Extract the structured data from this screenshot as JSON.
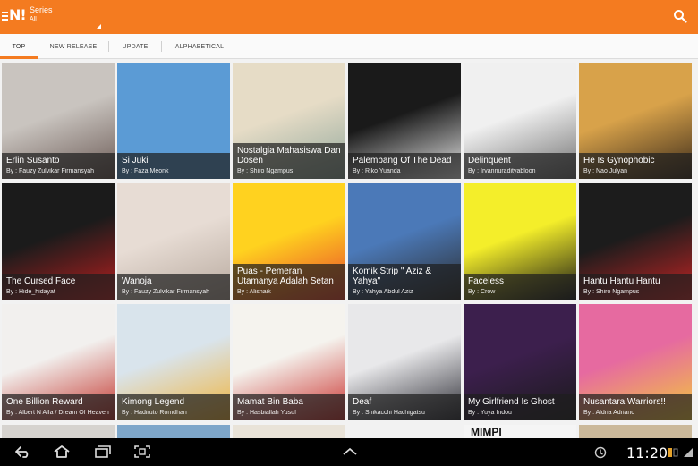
{
  "app": {
    "logo": "N!",
    "section_title": "Series",
    "section_filter": "All"
  },
  "tabs": [
    {
      "label": "TOP",
      "active": true
    },
    {
      "label": "NEW RELEASE",
      "active": false
    },
    {
      "label": "UPDATE",
      "active": false
    },
    {
      "label": "ALPHABETICAL",
      "active": false
    }
  ],
  "comics": [
    {
      "title": "Erlin Susanto",
      "author": "By : Fauzy Zulvikar Firmansyah",
      "colors": [
        "#c9c4bf",
        "#6b5a55"
      ]
    },
    {
      "title": "Si Juki",
      "author": "By : Faza Meonk",
      "colors": [
        "#5b9bd5",
        "#5b9bd5"
      ]
    },
    {
      "title": "Nostalgia Mahasiswa Dan Dosen",
      "author": "By : Shiro Ngampus",
      "colors": [
        "#e6dcc6",
        "#8fa69b"
      ]
    },
    {
      "title": "Palembang Of The Dead",
      "author": "By : Riko Yuanda",
      "colors": [
        "#1a1a1a",
        "#e8e8e8"
      ]
    },
    {
      "title": "Delinquent",
      "author": "By : Irvannuradityabloon",
      "colors": [
        "#f0f0f0",
        "#6f6f6f"
      ]
    },
    {
      "title": "He Is Gynophobic",
      "author": "By : Nao Julyan",
      "colors": [
        "#d8a24a",
        "#3a2a1a"
      ]
    },
    {
      "title": "The Cursed Face",
      "author": "By : Hide_hidayat",
      "colors": [
        "#1b1b1b",
        "#b81f1f"
      ]
    },
    {
      "title": "Wanoja",
      "author": "By : Fauzy Zulvikar Firmansyah",
      "colors": [
        "#e7dcd4",
        "#b7a99e"
      ]
    },
    {
      "title": "Puas - Pemeran Utamanya Adalah Setan",
      "author": "By : Alisnaik",
      "colors": [
        "#ffd21f",
        "#e7432b"
      ]
    },
    {
      "title": "Komik Strip \" Aziz & Yahya\"",
      "author": "By : Yahya Abdul Aziz",
      "colors": [
        "#4b79b8",
        "#2b2b2b"
      ]
    },
    {
      "title": "Faceless",
      "author": "By : Crow",
      "colors": [
        "#f4ee2a",
        "#161616"
      ]
    },
    {
      "title": "Hantu Hantu Hantu",
      "author": "By : Shiro Ngampus",
      "colors": [
        "#1c1c1c",
        "#c42424"
      ]
    },
    {
      "title": "One Billion Reward",
      "author": "By : Albert N Alfa / Dream Of Heaven",
      "colors": [
        "#f2f0ee",
        "#c2332b"
      ]
    },
    {
      "title": "Kimong Legend",
      "author": "By : Hadiruto Romdhan",
      "colors": [
        "#d9e4ec",
        "#f0b33a"
      ]
    },
    {
      "title": "Mamat Bin Baba",
      "author": "By : Hasbiallah Yusuf",
      "colors": [
        "#f5f3ee",
        "#c9302c"
      ]
    },
    {
      "title": "Deaf",
      "author": "By : Shikacchi Hachigatsu",
      "colors": [
        "#e8e8ea",
        "#2c2c34"
      ]
    },
    {
      "title": "My Girlfriend Is Ghost",
      "author": "By : Yuya Indou",
      "colors": [
        "#3c1f4d",
        "#1a1a1a"
      ]
    },
    {
      "title": "Nusantara Warriors!!",
      "author": "By : Aldria Adriano",
      "colors": [
        "#e66aa0",
        "#f3c93a"
      ]
    }
  ],
  "next_row_partial_text": "MIMPI",
  "status": {
    "time": "11:20"
  },
  "icons": {
    "menu": "menu-icon",
    "search": "search-icon",
    "back": "back-icon",
    "home": "home-icon",
    "recent": "recent-apps-icon",
    "screenshot": "screenshot-icon",
    "up": "chevron-up-icon"
  },
  "theme": {
    "accent": "#f47b20",
    "navbar": "#000000"
  }
}
